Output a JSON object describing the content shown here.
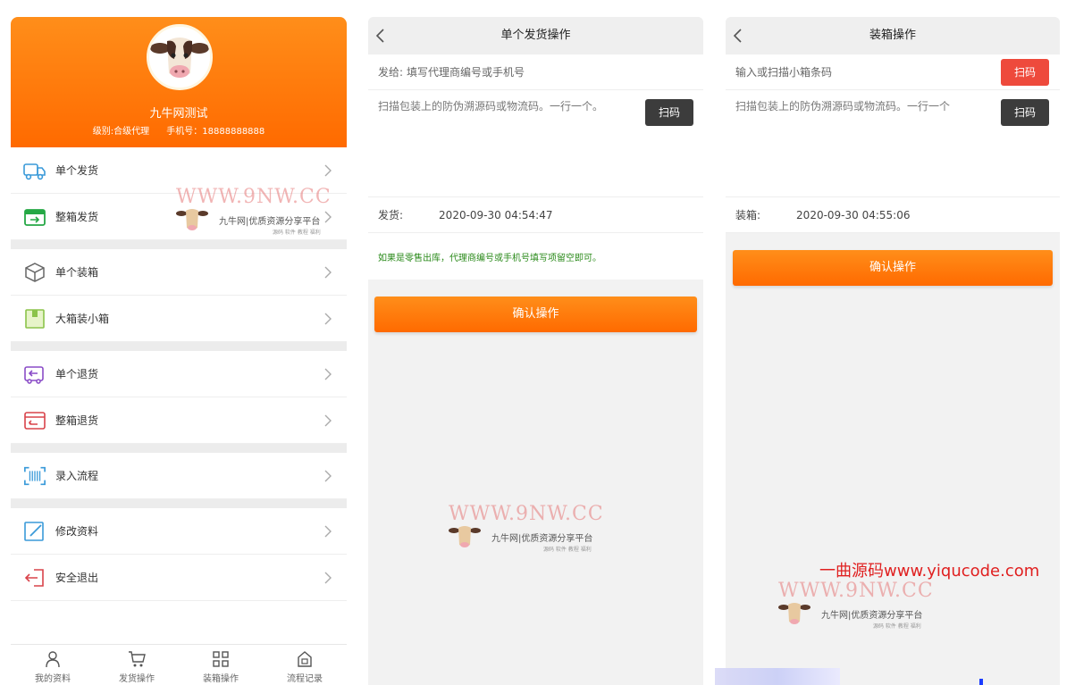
{
  "colors": {
    "orange": "#ff7a0e",
    "red": "#ee4a3c",
    "dark_button": "#3c3c3c",
    "green_hint": "#2a8a1a"
  },
  "profile": {
    "name": "九牛网测试",
    "level": "级别:合级代理",
    "phone": "手机号：18888888888"
  },
  "menu": {
    "groups": [
      [
        {
          "label": "单个发货",
          "icon": "truck-icon"
        },
        {
          "label": "整箱发货",
          "icon": "box-arrow-icon"
        }
      ],
      [
        {
          "label": "单个装箱",
          "icon": "cube-icon"
        },
        {
          "label": "大箱装小箱",
          "icon": "package-icon"
        }
      ],
      [
        {
          "label": "单个退货",
          "icon": "return-truck-icon"
        },
        {
          "label": "整箱退货",
          "icon": "return-box-icon"
        }
      ],
      [
        {
          "label": "录入流程",
          "icon": "barcode-scan-icon"
        }
      ],
      [
        {
          "label": "修改资料",
          "icon": "edit-icon"
        },
        {
          "label": "安全退出",
          "icon": "logout-icon"
        }
      ]
    ]
  },
  "tabbar": [
    {
      "label": "我的资料",
      "icon": "user-icon"
    },
    {
      "label": "发货操作",
      "icon": "cart-icon"
    },
    {
      "label": "装箱操作",
      "icon": "grid-icon"
    },
    {
      "label": "流程记录",
      "icon": "home-doc-icon"
    }
  ],
  "ship": {
    "title": "单个发货操作",
    "to_label": "发给:",
    "to_placeholder": "填写代理商编号或手机号",
    "codes_placeholder": "扫描包装上的防伪溯源码或物流码。一行一个。",
    "scan_label": "扫码",
    "time_label": "发货:",
    "time_value": "2020-09-30 04:54:47",
    "hint": "如果是零售出库，代理商编号或手机号填写项留空即可。",
    "confirm_label": "确认操作"
  },
  "pack": {
    "title": "装箱操作",
    "box_placeholder": "输入或扫描小箱条码",
    "box_scan_label": "扫码",
    "codes_placeholder": "扫描包装上的防伪溯源码或物流码。一行一个",
    "scan_label": "扫码",
    "time_label": "装箱:",
    "time_value": "2020-09-30 04:55:06",
    "confirm_label": "确认操作"
  },
  "watermark": {
    "url": "WWW.9NW.CC",
    "slogan": "九牛网|优质资源分享平台",
    "sub": "源码 软件 教程 福利"
  },
  "brand": "一曲源码www.yiqucode.com"
}
